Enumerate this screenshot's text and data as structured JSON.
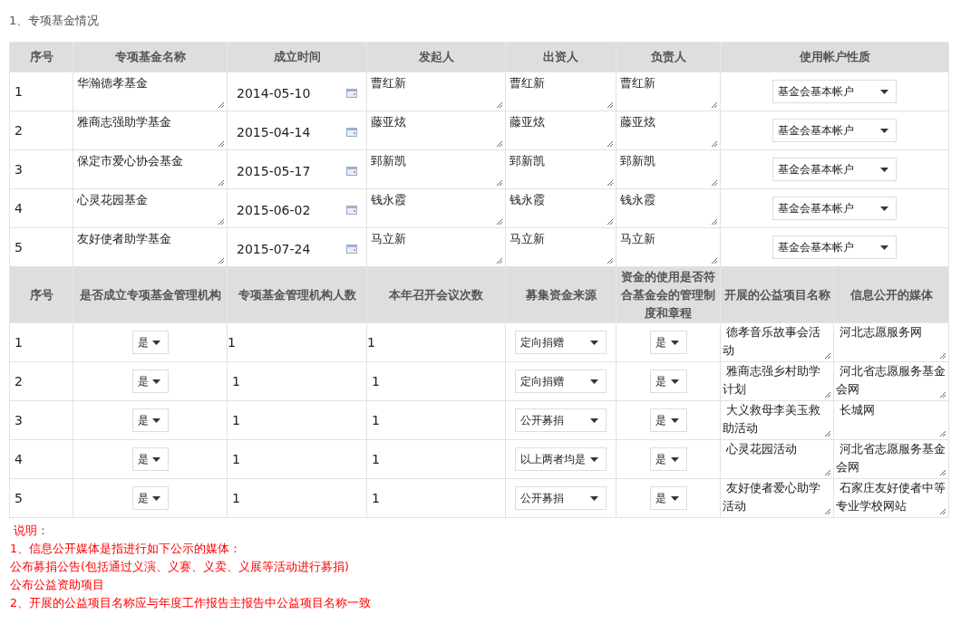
{
  "section_title": "1、专项基金情况",
  "funds_table": {
    "columns": [
      "序号",
      "专项基金名称",
      "成立时间",
      "发起人",
      "出资人",
      "负责人",
      "使用帐户性质"
    ],
    "rows": [
      {
        "index": "1",
        "name": "华瀚德孝基金",
        "founded": "2014-05-10",
        "initiator": "曹红新",
        "funder": "曹红新",
        "manager": "曹红新",
        "account_type": "基金会基本帐户"
      },
      {
        "index": "2",
        "name": "雅商志强助学基金",
        "founded": "2015-04-14",
        "initiator": "藤亚炫",
        "funder": "藤亚炫",
        "manager": "藤亚炫",
        "account_type": "基金会基本帐户"
      },
      {
        "index": "3",
        "name": "保定市爱心协会基金",
        "founded": "2015-05-17",
        "initiator": "郅新凯",
        "funder": "郅新凯",
        "manager": "郅新凯",
        "account_type": "基金会基本帐户"
      },
      {
        "index": "4",
        "name": "心灵花园基金",
        "founded": "2015-06-02",
        "initiator": "钱永霞",
        "funder": "钱永霞",
        "manager": "钱永霞",
        "account_type": "基金会基本帐户"
      },
      {
        "index": "5",
        "name": "友好使者助学基金",
        "founded": "2015-07-24",
        "initiator": "马立新",
        "funder": "马立新",
        "manager": "马立新",
        "account_type": "基金会基本帐户"
      }
    ]
  },
  "management_table": {
    "columns": [
      "序号",
      "是否成立专项基金管理机构",
      "专项基金管理机构人数",
      "本年召开会议次数",
      "募集资金来源",
      "资金的使用是否符合基金会的管理制度和章程",
      "开展的公益项目名称",
      "信息公开的媒体"
    ],
    "rows": [
      {
        "index": "1",
        "has_org": "是",
        "org_members": "1",
        "meetings": "1",
        "fund_source": "定向捐赠",
        "compliant": "是",
        "project": " 德孝音乐故事会活动",
        "media": " 河北志愿服务网"
      },
      {
        "index": "2",
        "has_org": "是",
        "org_members": "1",
        "meetings": "1",
        "fund_source": "定向捐赠",
        "compliant": "是",
        "project": " 雅商志强乡村助学计划",
        "media": " 河北省志愿服务基金会网"
      },
      {
        "index": "3",
        "has_org": "是",
        "org_members": "1",
        "meetings": "1",
        "fund_source": "公开募捐",
        "compliant": "是",
        "project": " 大义救母李美玉救助活动",
        "media": " 长城网"
      },
      {
        "index": "4",
        "has_org": "是",
        "org_members": "1",
        "meetings": "1",
        "fund_source": "以上两者均是",
        "compliant": "是",
        "project": " 心灵花园活动",
        "media": " 河北省志愿服务基金会网"
      },
      {
        "index": "5",
        "has_org": "是",
        "org_members": "1",
        "meetings": "1",
        "fund_source": "公开募捐",
        "compliant": "是",
        "project": " 友好使者爱心助学活动",
        "media": " 石家庄友好使者中等专业学校网站"
      }
    ]
  },
  "notes": [
    " 说明：",
    "1、信息公开媒体是指进行如下公示的媒体：",
    "公布募捐公告(包括通过义演、义赛、义卖、义展等活动进行募捐)",
    "公布公益资助项目",
    "2、开展的公益项目名称应与年度工作报告主报告中公益项目名称一致"
  ]
}
